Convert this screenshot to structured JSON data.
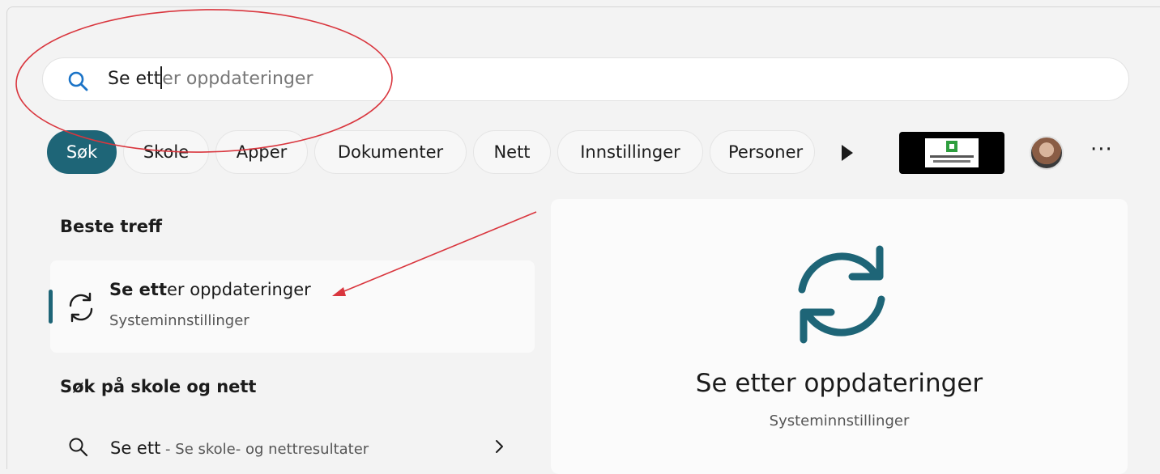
{
  "search": {
    "typed": "Se ett",
    "suggestion": "er oppdateringer"
  },
  "filters": {
    "chips": [
      "Søk",
      "Skole",
      "Apper",
      "Dokumenter",
      "Nett",
      "Innstillinger",
      "Personer"
    ],
    "active_index": 0
  },
  "best_match": {
    "section_title": "Beste treff",
    "title_bold": "Se ett",
    "title_rest": "er oppdateringer",
    "subtitle": "Systeminnstillinger"
  },
  "web": {
    "section_title": "Søk på skole og nett",
    "query": "Se ett",
    "hint": " - Se skole- og nettresultater"
  },
  "preview": {
    "title": "Se etter oppdateringer",
    "subtitle": "Systeminnstillinger"
  },
  "colors": {
    "accent": "#1e6577",
    "annotation": "#d9363e"
  },
  "icons": {
    "search": "search-icon",
    "update": "refresh-icon",
    "more": "more-dots-icon"
  }
}
